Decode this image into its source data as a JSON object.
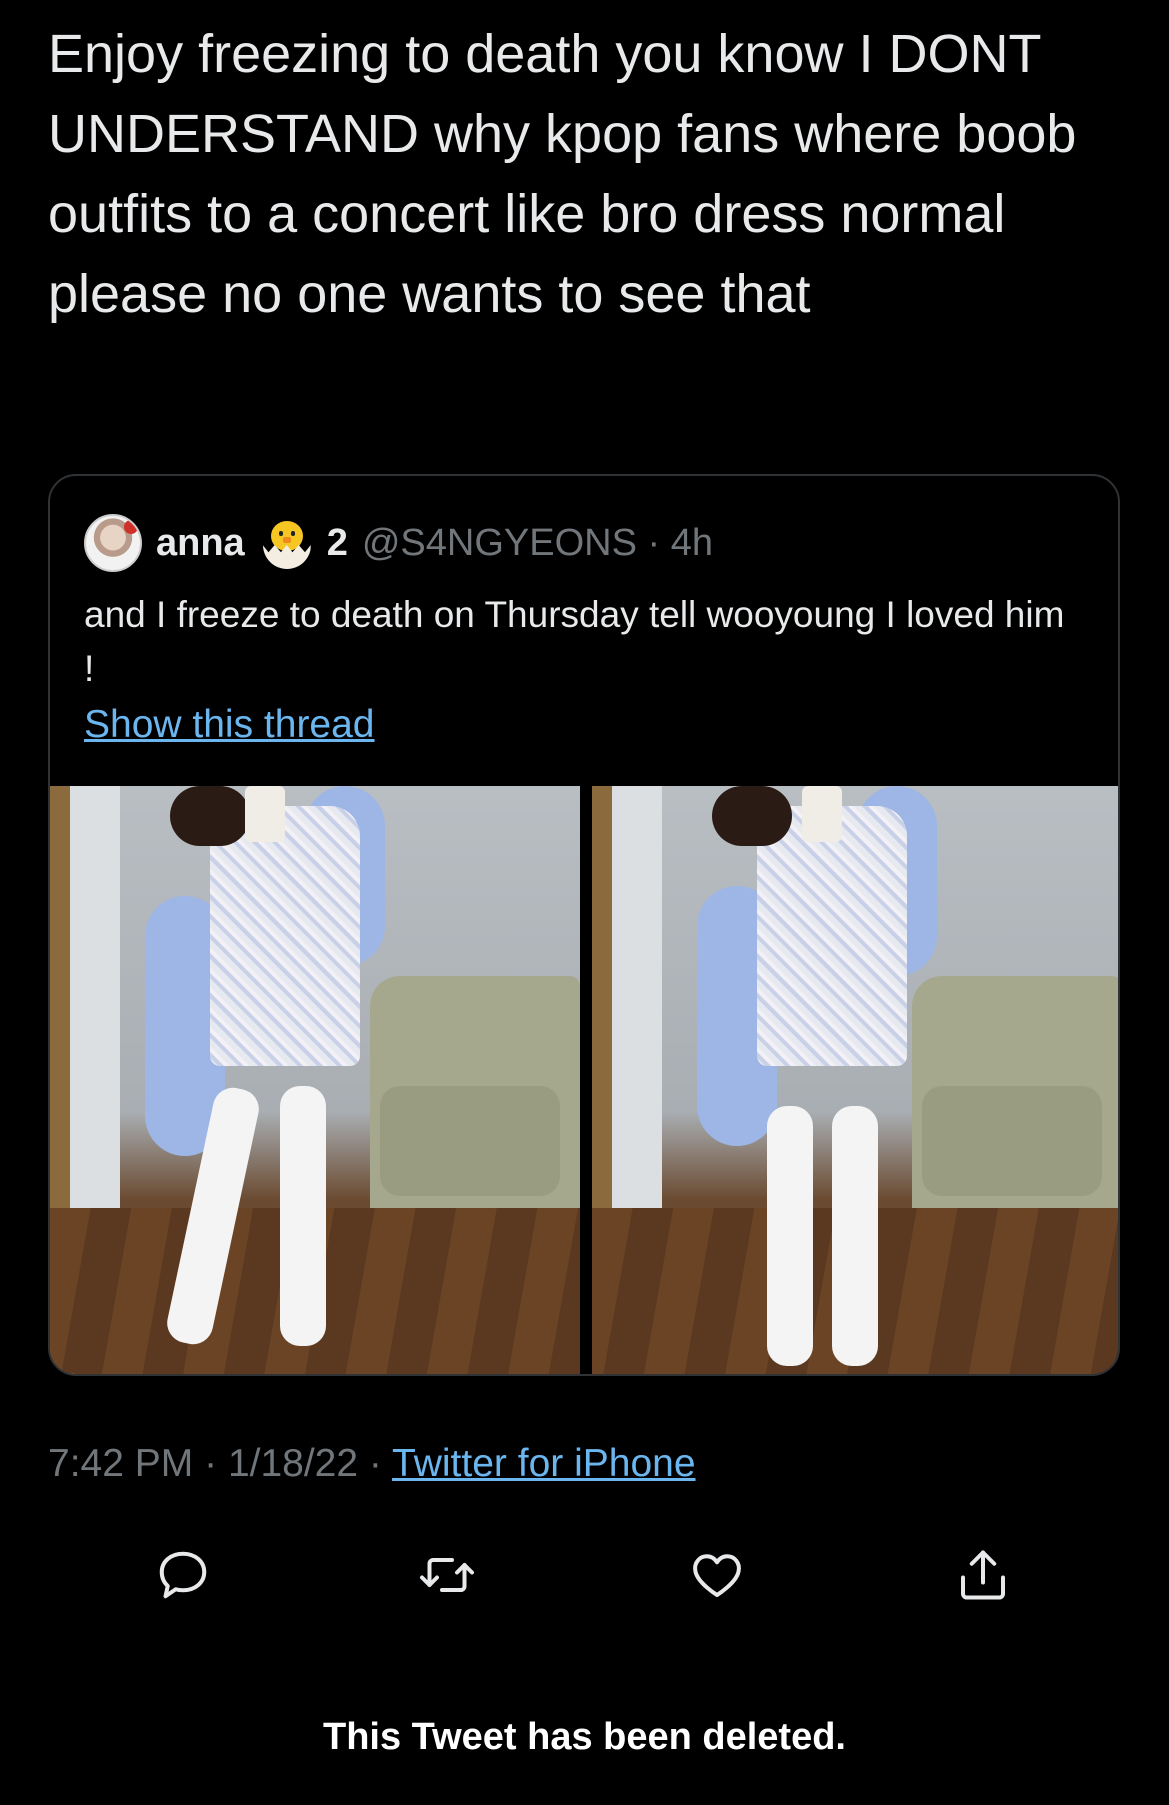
{
  "tweet": {
    "text": "Enjoy freezing to death you know I DONT UNDERSTAND why kpop fans where boob outfits to a concert like bro dress normal please no one wants to see that",
    "time": "7:42 PM",
    "date": "1/18/22",
    "source": "Twitter for iPhone",
    "separator": "·"
  },
  "quote": {
    "display_name": "anna",
    "badge_number": "2",
    "handle": "@S4NGYEONS",
    "age": "4h",
    "text": "and I freeze to death on Thursday tell wooyoung I loved him !",
    "show_thread": "Show this thread"
  },
  "actions": {
    "reply_icon": "reply-icon",
    "retweet_icon": "retweet-icon",
    "like_icon": "heart-icon",
    "share_icon": "share-icon"
  },
  "footer": {
    "deleted_notice": "This Tweet has been deleted."
  },
  "colors": {
    "background": "#000000",
    "text": "#e7e9ea",
    "muted": "#71767b",
    "link": "#6cb6f0",
    "border": "#2f3336"
  }
}
